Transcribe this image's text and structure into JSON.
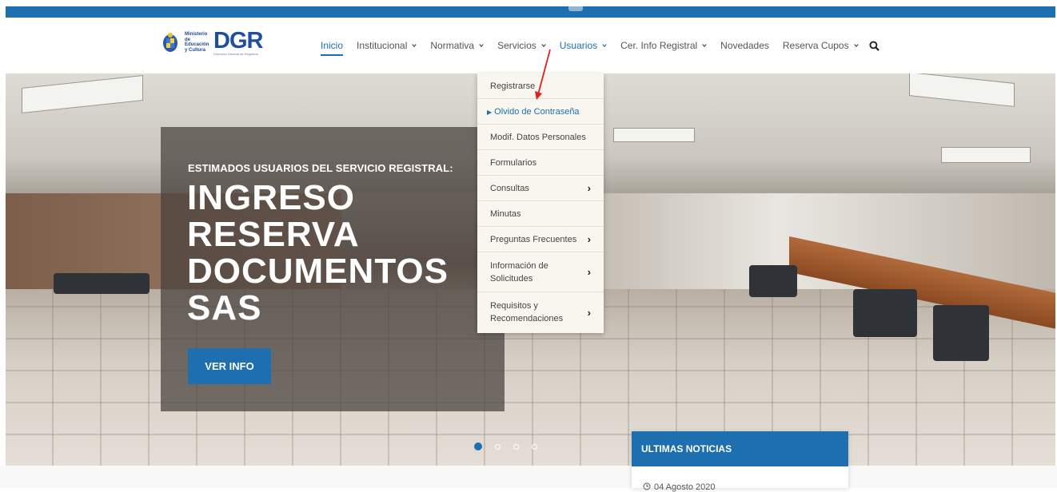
{
  "brand": {
    "ministry_lines": [
      "Ministerio",
      "de Educación",
      "y Cultura"
    ],
    "name": "DGR",
    "subtitle": "Dirección General de Registros"
  },
  "nav": {
    "items": [
      {
        "label": "Inicio",
        "has_dropdown": false,
        "state": "active"
      },
      {
        "label": "Institucional",
        "has_dropdown": true
      },
      {
        "label": "Normativa",
        "has_dropdown": true
      },
      {
        "label": "Servicios",
        "has_dropdown": true
      },
      {
        "label": "Usuarios",
        "has_dropdown": true,
        "state": "open"
      },
      {
        "label": "Cer. Info Registral",
        "has_dropdown": true
      },
      {
        "label": "Novedades",
        "has_dropdown": false
      },
      {
        "label": "Reserva Cupos",
        "has_dropdown": true
      }
    ],
    "search_icon": "search-icon"
  },
  "dropdown": {
    "items": [
      {
        "label": "Registrarse",
        "submenu": false
      },
      {
        "label": "Olvido de Contraseña",
        "submenu": false,
        "highlighted": true
      },
      {
        "label": "Modif. Datos Personales",
        "submenu": false
      },
      {
        "label": "Formularios",
        "submenu": false
      },
      {
        "label": "Consultas",
        "submenu": true
      },
      {
        "label": "Minutas",
        "submenu": false
      },
      {
        "label": "Preguntas Frecuentes",
        "submenu": true
      },
      {
        "label": "Información de Solicitudes",
        "submenu": true
      },
      {
        "label": "Requisitos y Recomendaciones",
        "submenu": true
      }
    ]
  },
  "hero": {
    "kicker": "ESTIMADOS USUARIOS DEL SERVICIO REGISTRAL:",
    "title_lines": [
      "INGRESO",
      "RESERVA",
      "DOCUMENTOS",
      "SAS"
    ],
    "cta": "VER INFO",
    "slides": 4,
    "active_slide": 1
  },
  "news": {
    "heading": "ULTIMAS NOTICIAS",
    "first_date": "04 Agosto 2020"
  },
  "colors": {
    "accent": "#1d6fb0",
    "annotation_arrow": "#e02020"
  }
}
